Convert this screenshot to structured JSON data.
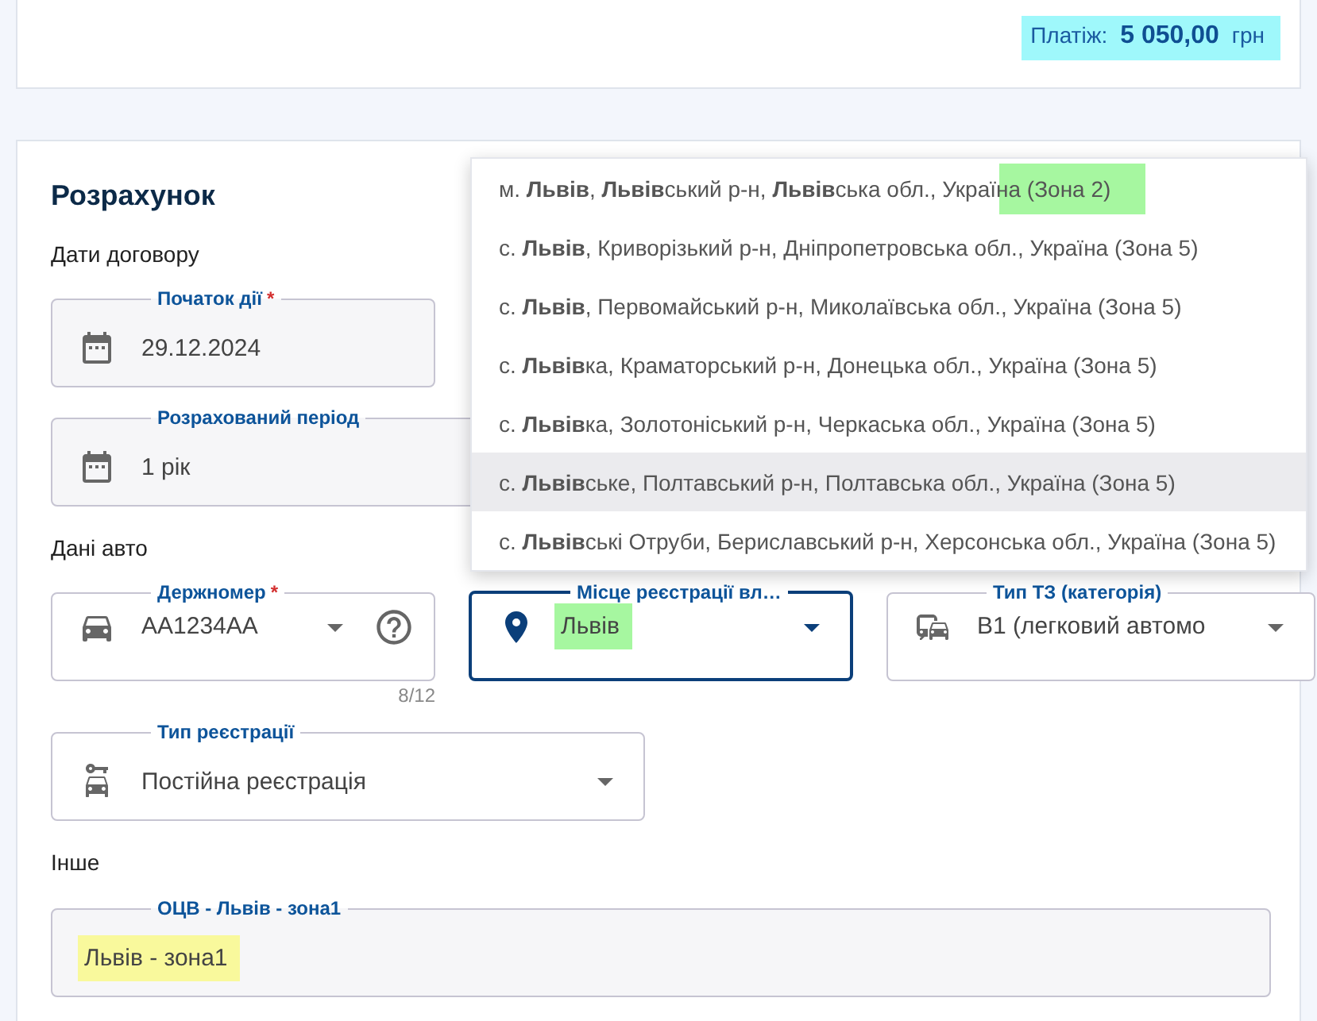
{
  "payment": {
    "label": "Платіж:",
    "amount": "5 050,00",
    "currency": "грн",
    "color": "#9ff8fb"
  },
  "section": {
    "title": "Розрахунок"
  },
  "contract_dates": {
    "heading": "Дати договору",
    "fields": [
      {
        "kind": "date",
        "label": "Початок дії",
        "required_mark": "*",
        "value": "29.12.2024"
      },
      {
        "kind": "date",
        "label": "Розрахований період",
        "value": "1 рік"
      }
    ]
  },
  "car": {
    "heading": "Дані авто",
    "fields": [
      {
        "kind": "plate",
        "label": "Держномер",
        "required_mark": "*",
        "value": "AA1234AA",
        "dropdown": true,
        "help": true,
        "counter": "8/12",
        "focused": false
      },
      {
        "kind": "place",
        "label": "Місце реєстрації вл…",
        "value": "Львів",
        "dropdown": true,
        "focused": true,
        "color": "#a6f7a0"
      },
      {
        "kind": "vehicle",
        "label": "Тип ТЗ (категорія)",
        "value": "B1 (легковий автомо",
        "dropdown": true,
        "focused": false
      }
    ],
    "registration": {
      "kind": "registration",
      "label": "Тип реєстрації",
      "value": "Постійна реєстрація",
      "dropdown": true,
      "focused": false
    }
  },
  "other": {
    "heading": "Інше",
    "field": {
      "kind": "plain",
      "label": "ОЦВ - Львів - зона1",
      "value": "Львів - зона1",
      "color": "#f9f99c"
    }
  },
  "suggestions": [
    {
      "text": "м. **Львів**, **Львів**ський р-н, **Львів**ська обл., Україна (Зона 2)",
      "hovered": false,
      "color": "#a6f7a0"
    },
    {
      "text": "с. **Львів**, Криворізький р-н, Дніпропетровська обл., Україна (Зона 5)",
      "hovered": false
    },
    {
      "text": "с. **Львів**, Первомайський р-н, Миколаївська обл., Україна (Зона 5)",
      "hovered": false
    },
    {
      "text": "с. **Львів**ка, Краматорський р-н, Донецька обл., Україна (Зона 5)",
      "hovered": false
    },
    {
      "text": "с. **Львів**ка, Золотоніський р-н, Черкаська обл., Україна (Зона 5)",
      "hovered": false
    },
    {
      "text": "с. **Львів**ське, Полтавський р-н, Полтавська обл., Україна (Зона 5)",
      "hovered": true
    },
    {
      "text": "с. **Львів**ські Отруби, Бериславський р-н, Херсонська обл., Україна (Зона 5)",
      "hovered": false
    }
  ]
}
